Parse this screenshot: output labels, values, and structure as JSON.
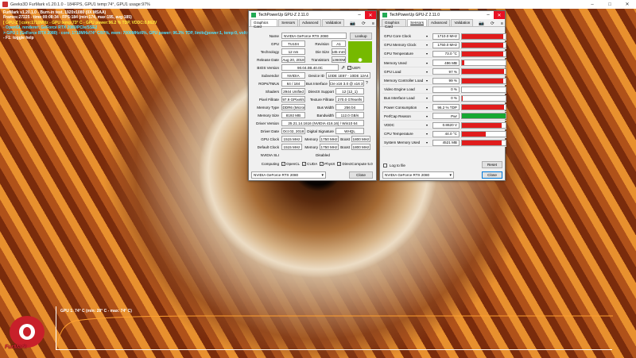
{
  "furmark_title": "Geeks3D FurMark v1.20.1.0 - 184FPS, GPU1 temp:74°, GPU1 usage:97%",
  "overlay": [
    {
      "text": "FurMark v1.20.1.0 - Burn-in test, 1920x1080 (0X MSAA)",
      "cls": ""
    },
    {
      "text": "Frames:27225 - time:00:08:34 - FPS:184 (min:174, max:195, avg:185)",
      "cls": ""
    },
    {
      "text": "[ GPU-Z ] core:1710MHz - GPU temp:73° C - GPU power:96.2 % TDP, VDDC:0.862V",
      "cls": "y"
    },
    {
      "text": "- OpenGL renderer: GeForce RTX 2080/PCIe/SSE2",
      "cls": "c"
    },
    {
      "text": "> GPU 1 (GeForce RTX 2080) - core: 1710MHz/74° C/97%, mem: 7000MHz/6%, GPU power: 96.2% TDP, limits[power:1, temp:0, volt:0, OV:0]",
      "cls": "c"
    },
    {
      "text": "- F1: toggle help",
      "cls": ""
    }
  ],
  "graph_label": "GPU 1: 74° C (min: 28° C - max: 74° C)",
  "logo_text": "FurMark",
  "gpuz1": {
    "title": "TechPowerUp GPU-Z 2.11.0",
    "tabs": [
      "Graphics Card",
      "Sensors",
      "Advanced",
      "Validation"
    ],
    "name": "NVIDIA GeForce RTX 2080",
    "lookup": "Lookup",
    "gpu": "TU104",
    "revision": "A1",
    "technology": "12 nm",
    "die_size": "545 mm²",
    "release_date": "Aug 20, 2018",
    "transistors": "13600M",
    "bios": "90.04.0B.40.0C",
    "uefi": "UEFI",
    "subvendor": "NVIDIA",
    "device_id": "10DE 1E87 - 10DE 12A4",
    "rops": "64 / 184",
    "bus_interface": "PCIe x16 3.0 @ x16 3.0",
    "shaders": "2944 Unified",
    "directx": "12 (12_1)",
    "pixel_fillrate": "97.9 GPixel/s",
    "texture_fillrate": "270.0 GTexel/s",
    "memory_type": "GDDR6 (Micron)",
    "bus_width": "256 bit",
    "memory_size": "8192 MB",
    "bandwidth": "112.0 GB/s",
    "driver_version": "25.21.14.1616 (NVIDIA 416.16) / Win10 64",
    "driver_date": "Oct 02, 2018",
    "digital_signature": "WHQL",
    "gpu_clock": "1515 MHz",
    "memory_clock": "1750 MHz",
    "boost": "1800 MHz",
    "default_clock": "1515 MHz",
    "default_memory": "1750 MHz",
    "default_boost": "1800 MHz",
    "sli": "Disabled",
    "computing": [
      "OpenCL",
      "CUDA",
      "PhysX",
      "DirectCompute 5.0"
    ],
    "select": "NVIDIA GeForce RTX 2080",
    "close": "Close",
    "labels": {
      "name": "Name",
      "gpu": "GPU",
      "revision": "Revision",
      "technology": "Technology",
      "die_size": "Die Size",
      "release_date": "Release Date",
      "transistors": "Transistors",
      "bios": "BIOS Version",
      "subvendor": "Subvendor",
      "device_id": "Device ID",
      "rops": "ROPs/TMUs",
      "bus_interface": "Bus Interface",
      "shaders": "Shaders",
      "directx": "DirectX Support",
      "pixel_fillrate": "Pixel Fillrate",
      "texture_fillrate": "Texture Fillrate",
      "memory_type": "Memory Type",
      "bus_width": "Bus Width",
      "memory_size": "Memory Size",
      "bandwidth": "Bandwidth",
      "driver_version": "Driver Version",
      "driver_date": "Driver Date",
      "digital_signature": "Digital Signature",
      "gpu_clock": "GPU Clock",
      "memory": "Memory",
      "boost": "Boost",
      "default_clock": "Default Clock",
      "sli": "NVIDIA SLI",
      "computing": "Computing"
    }
  },
  "gpuz2": {
    "title": "TechPowerUp GPU-Z 2.11.0",
    "tabs": [
      "Graphics Card",
      "Sensors",
      "Advanced",
      "Validation"
    ],
    "sensors": [
      {
        "label": "GPU Core Clock",
        "value": "1710.0 MHz",
        "fill": 0.95,
        "color": "#e01c1c"
      },
      {
        "label": "GPU Memory Clock",
        "value": "1750.0 MHz",
        "fill": 0.95,
        "color": "#e01c1c"
      },
      {
        "label": "GPU Temperature",
        "value": "73.0 °C",
        "fill": 0.95,
        "color": "#e01c1c"
      },
      {
        "label": "Memory Used",
        "value": "496 MB",
        "fill": 0.06,
        "color": "#e01c1c"
      },
      {
        "label": "GPU Load",
        "value": "97 %",
        "fill": 0.97,
        "color": "#e01c1c"
      },
      {
        "label": "Memory Controller Load",
        "value": "99 %",
        "fill": 0.95,
        "color": "#e01c1c"
      },
      {
        "label": "Video Engine Load",
        "value": "0 %",
        "fill": 0,
        "color": "#e01c1c"
      },
      {
        "label": "Bus Interface Load",
        "value": "0 %",
        "fill": 0.02,
        "color": "#e01c1c"
      },
      {
        "label": "Power Consumption",
        "value": "96.2 % TDP",
        "fill": 0.96,
        "color": "#e01c1c"
      },
      {
        "label": "PerfCap Reason",
        "value": "Pwr",
        "fill": 1.0,
        "color": "#16a832"
      },
      {
        "label": "VDDC",
        "value": "0.8620 V",
        "fill": 0.9,
        "color": "#e01c1c"
      },
      {
        "label": "CPU Temperature",
        "value": "44.0 °C",
        "fill": 0.55,
        "color": "#e01c1c"
      },
      {
        "label": "System Memory Used",
        "value": "4521 MB",
        "fill": 0.9,
        "color": "#e01c1c"
      }
    ],
    "log_to_file": "Log to file",
    "reset": "Reset",
    "select": "NVIDIA GeForce RTX 2080",
    "close": "Close"
  }
}
